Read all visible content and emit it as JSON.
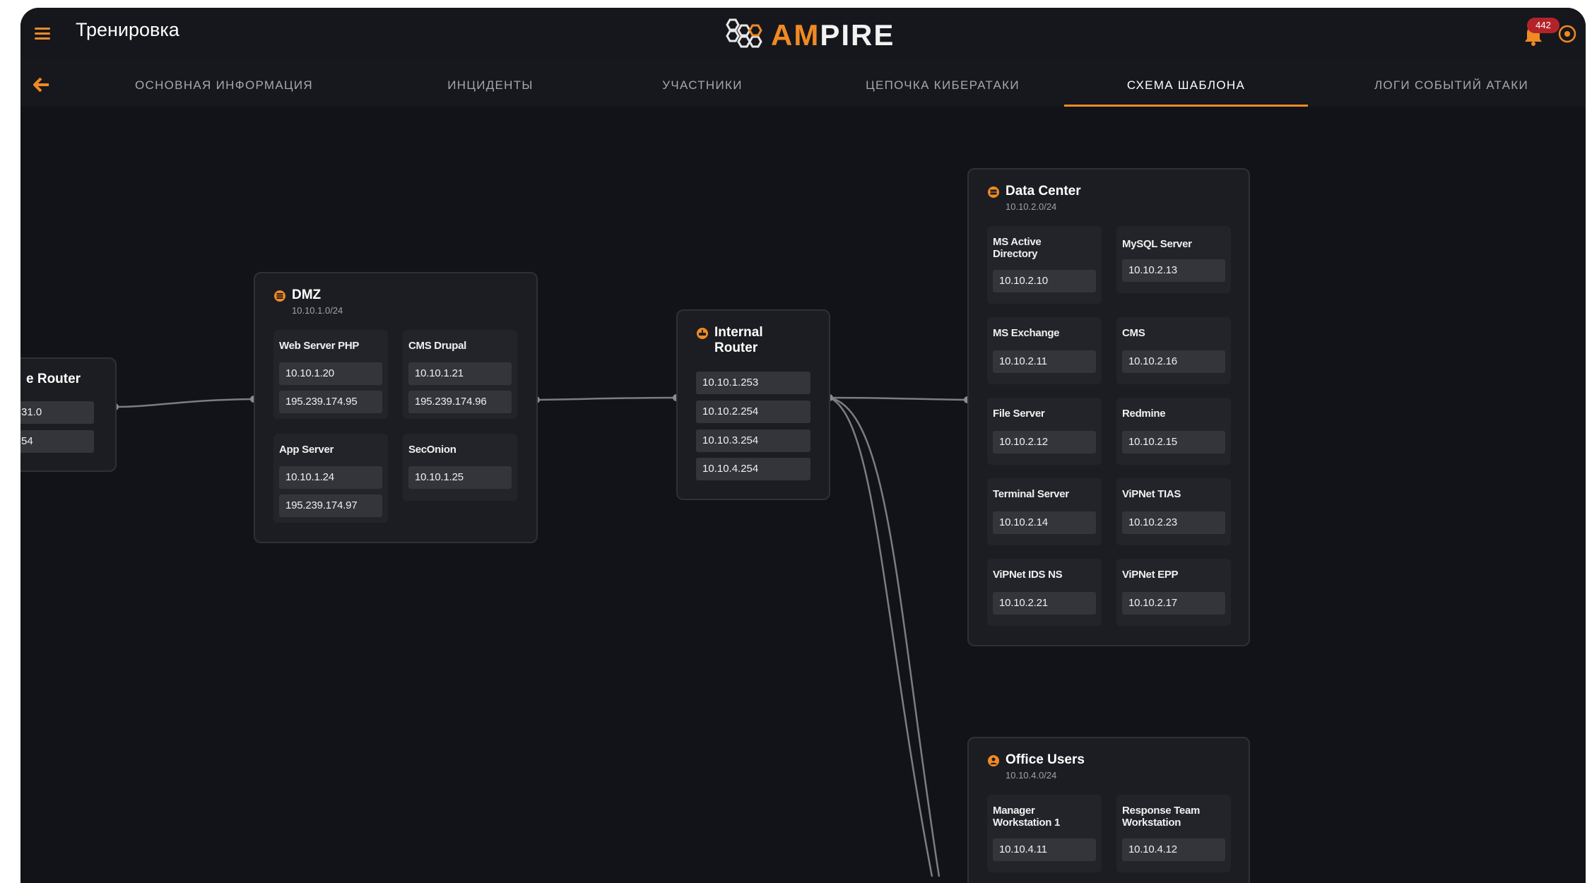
{
  "header": {
    "title": "Тренировка",
    "logo_accent": "AM",
    "logo_rest": "PIRE",
    "notification_count": "442"
  },
  "colors": {
    "accent": "#f08a24",
    "background": "#121318",
    "panel": "#1c1d22",
    "badge": "#b3242a"
  },
  "tabs": [
    {
      "label": "ОСНОВНАЯ ИНФОРМАЦИЯ"
    },
    {
      "label": "ИНЦИДЕНТЫ"
    },
    {
      "label": "УЧАСТНИКИ"
    },
    {
      "label": "ЦЕПОЧКА КИБЕРАТАКИ"
    },
    {
      "label": "СХЕМА ШАБЛОНА"
    },
    {
      "label": "ЛОГИ СОБЫТИЙ АТАКИ"
    }
  ],
  "diagram": {
    "edge_router": {
      "name": "e Router",
      "ips": [
        "31.0",
        "54"
      ]
    },
    "dmz": {
      "name": "DMZ",
      "network": "10.10.1.0/24",
      "hosts": [
        {
          "name": "Web Server PHP",
          "ips": [
            "10.10.1.20",
            "195.239.174.95"
          ]
        },
        {
          "name": "CMS Drupal",
          "ips": [
            "10.10.1.21",
            "195.239.174.96"
          ]
        },
        {
          "name": "App Server",
          "ips": [
            "10.10.1.24",
            "195.239.174.97"
          ]
        },
        {
          "name": "SecOnion",
          "ips": [
            "10.10.1.25"
          ]
        }
      ]
    },
    "internal_router": {
      "name_line1": "Internal",
      "name_line2": "Router",
      "ips": [
        "10.10.1.253",
        "10.10.2.254",
        "10.10.3.254",
        "10.10.4.254"
      ]
    },
    "data_center": {
      "name": "Data Center",
      "network": "10.10.2.0/24",
      "hosts": [
        {
          "name1": "MS Active",
          "name2": "Directory",
          "ip": "10.10.2.10"
        },
        {
          "name1": "MySQL Server",
          "name2": "",
          "ip": "10.10.2.13"
        },
        {
          "name1": "MS Exchange",
          "name2": "",
          "ip": "10.10.2.11"
        },
        {
          "name1": "CMS",
          "name2": "",
          "ip": "10.10.2.16"
        },
        {
          "name1": "File Server",
          "name2": "",
          "ip": "10.10.2.12"
        },
        {
          "name1": "Redmine",
          "name2": "",
          "ip": "10.10.2.15"
        },
        {
          "name1": "Terminal Server",
          "name2": "",
          "ip": "10.10.2.14"
        },
        {
          "name1": "ViPNet TIAS",
          "name2": "",
          "ip": "10.10.2.23"
        },
        {
          "name1": "ViPNet IDS NS",
          "name2": "",
          "ip": "10.10.2.21"
        },
        {
          "name1": "ViPNet EPP",
          "name2": "",
          "ip": "10.10.2.17"
        }
      ]
    },
    "office_users": {
      "name": "Office Users",
      "network": "10.10.4.0/24",
      "hosts": [
        {
          "name1": "Manager",
          "name2": "Workstation 1",
          "ip": "10.10.4.11"
        },
        {
          "name1": "Response Team",
          "name2": "Workstation",
          "ip": "10.10.4.12"
        }
      ]
    }
  }
}
